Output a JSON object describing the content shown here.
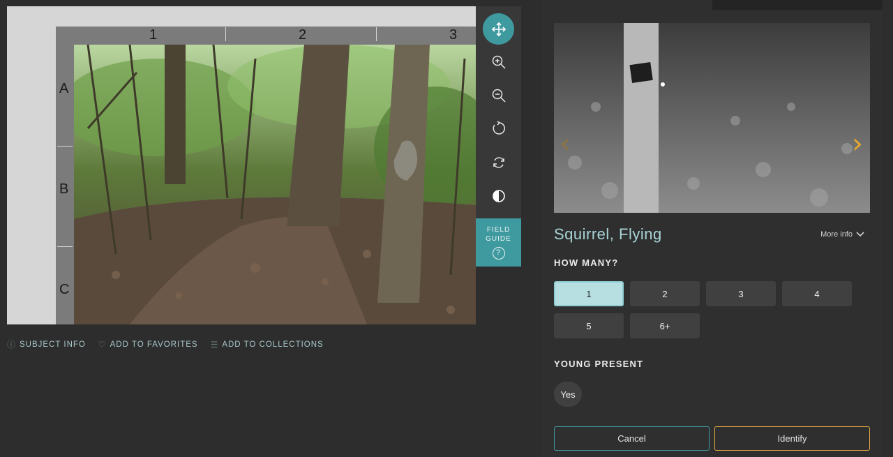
{
  "viewer": {
    "columns": [
      "1",
      "2",
      "3"
    ],
    "rows": [
      "A",
      "B",
      "C"
    ],
    "tools": [
      {
        "name": "move-icon",
        "glyph": "✥"
      },
      {
        "name": "zoom-in-icon",
        "glyph": "+"
      },
      {
        "name": "zoom-out-icon",
        "glyph": "−"
      },
      {
        "name": "rotate-icon",
        "glyph": "↻"
      },
      {
        "name": "reset-icon",
        "glyph": "⟲"
      },
      {
        "name": "invert-icon",
        "glyph": "◑"
      }
    ],
    "field_guide": {
      "line1": "FIELD",
      "line2": "GUIDE",
      "help": "?"
    }
  },
  "meta": {
    "subject_info": "SUBJECT INFO",
    "favorites": "ADD TO FAVORITES",
    "collections": "ADD TO COLLECTIONS"
  },
  "panel": {
    "species_name": "Squirrel, Flying",
    "more_info": "More info",
    "how_many_title": "HOW MANY?",
    "counts": [
      "1",
      "2",
      "3",
      "4",
      "5",
      "6+"
    ],
    "selected_count": "1",
    "young_title": "YOUNG PRESENT",
    "young_yes": "Yes",
    "cancel_label": "Cancel",
    "identify_label": "Identify",
    "arrow_prev": "‹",
    "arrow_next": "›"
  },
  "colors": {
    "accent_teal": "#3f9aa0",
    "identify_border": "#e0a840",
    "species_text": "#a8d4d7"
  }
}
